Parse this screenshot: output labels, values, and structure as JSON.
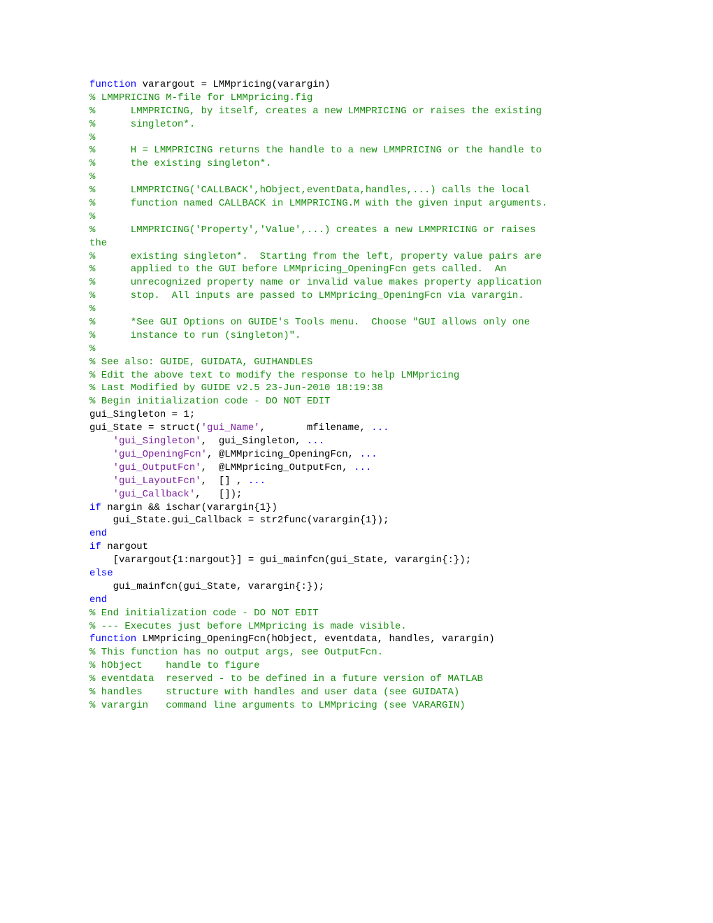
{
  "code": [
    [
      [
        "kw",
        "function"
      ],
      [
        "blk",
        " varargout = LMMpricing(varargin)"
      ]
    ],
    [
      [
        "com",
        "% LMMPRICING M-file for LMMpricing.fig"
      ]
    ],
    [
      [
        "com",
        "%      LMMPRICING, by itself, creates a new LMMPRICING or raises the existing"
      ]
    ],
    [
      [
        "com",
        "%      singleton*."
      ]
    ],
    [
      [
        "com",
        "%"
      ]
    ],
    [
      [
        "com",
        "%      H = LMMPRICING returns the handle to a new LMMPRICING or the handle to"
      ]
    ],
    [
      [
        "com",
        "%      the existing singleton*."
      ]
    ],
    [
      [
        "com",
        "%"
      ]
    ],
    [
      [
        "com",
        "%      LMMPRICING('CALLBACK',hObject,eventData,handles,...) calls the local"
      ]
    ],
    [
      [
        "com",
        "%      function named CALLBACK in LMMPRICING.M with the given input arguments."
      ]
    ],
    [
      [
        "com",
        "%"
      ]
    ],
    [
      [
        "com",
        "%      LMMPRICING('Property','Value',...) creates a new LMMPRICING or raises"
      ]
    ],
    [
      [
        "com",
        "the"
      ]
    ],
    [
      [
        "com",
        "%      existing singleton*.  Starting from the left, property value pairs are"
      ]
    ],
    [
      [
        "com",
        "%      applied to the GUI before LMMpricing_OpeningFcn gets called.  An"
      ]
    ],
    [
      [
        "com",
        "%      unrecognized property name or invalid value makes property application"
      ]
    ],
    [
      [
        "com",
        "%      stop.  All inputs are passed to LMMpricing_OpeningFcn via varargin."
      ]
    ],
    [
      [
        "com",
        "%"
      ]
    ],
    [
      [
        "com",
        "%      *See GUI Options on GUIDE's Tools menu.  Choose \"GUI allows only one"
      ]
    ],
    [
      [
        "com",
        "%      instance to run (singleton)\"."
      ]
    ],
    [
      [
        "com",
        "%"
      ]
    ],
    [
      [
        "com",
        "% See also: GUIDE, GUIDATA, GUIHANDLES"
      ]
    ],
    [
      [
        "blk",
        ""
      ]
    ],
    [
      [
        "com",
        "% Edit the above text to modify the response to help LMMpricing"
      ]
    ],
    [
      [
        "blk",
        ""
      ]
    ],
    [
      [
        "com",
        "% Last Modified by GUIDE v2.5 23-Jun-2010 18:19:38"
      ]
    ],
    [
      [
        "blk",
        ""
      ]
    ],
    [
      [
        "com",
        "% Begin initialization code - DO NOT EDIT"
      ]
    ],
    [
      [
        "blk",
        "gui_Singleton = 1;"
      ]
    ],
    [
      [
        "blk",
        "gui_State = struct("
      ],
      [
        "str",
        "'gui_Name'"
      ],
      [
        "blk",
        ",       mfilename, "
      ],
      [
        "kw",
        "..."
      ]
    ],
    [
      [
        "blk",
        "    "
      ],
      [
        "str",
        "'gui_Singleton'"
      ],
      [
        "blk",
        ",  gui_Singleton, "
      ],
      [
        "kw",
        "..."
      ]
    ],
    [
      [
        "blk",
        "    "
      ],
      [
        "str",
        "'gui_OpeningFcn'"
      ],
      [
        "blk",
        ", @LMMpricing_OpeningFcn, "
      ],
      [
        "kw",
        "..."
      ]
    ],
    [
      [
        "blk",
        "    "
      ],
      [
        "str",
        "'gui_OutputFcn'"
      ],
      [
        "blk",
        ",  @LMMpricing_OutputFcn, "
      ],
      [
        "kw",
        "..."
      ]
    ],
    [
      [
        "blk",
        "    "
      ],
      [
        "str",
        "'gui_LayoutFcn'"
      ],
      [
        "blk",
        ",  [] , "
      ],
      [
        "kw",
        "..."
      ]
    ],
    [
      [
        "blk",
        "    "
      ],
      [
        "str",
        "'gui_Callback'"
      ],
      [
        "blk",
        ",   []);"
      ]
    ],
    [
      [
        "kw",
        "if"
      ],
      [
        "blk",
        " nargin && ischar(varargin{1})"
      ]
    ],
    [
      [
        "blk",
        "    gui_State.gui_Callback = str2func(varargin{1});"
      ]
    ],
    [
      [
        "kw",
        "end"
      ]
    ],
    [
      [
        "blk",
        ""
      ]
    ],
    [
      [
        "kw",
        "if"
      ],
      [
        "blk",
        " nargout"
      ]
    ],
    [
      [
        "blk",
        "    [varargout{1:nargout}] = gui_mainfcn(gui_State, varargin{:});"
      ]
    ],
    [
      [
        "kw",
        "else"
      ]
    ],
    [
      [
        "blk",
        "    gui_mainfcn(gui_State, varargin{:});"
      ]
    ],
    [
      [
        "kw",
        "end"
      ]
    ],
    [
      [
        "com",
        "% End initialization code - DO NOT EDIT"
      ]
    ],
    [
      [
        "blk",
        ""
      ]
    ],
    [
      [
        "blk",
        ""
      ]
    ],
    [
      [
        "com",
        "% --- Executes just before LMMpricing is made visible."
      ]
    ],
    [
      [
        "kw",
        "function"
      ],
      [
        "blk",
        " LMMpricing_OpeningFcn(hObject, eventdata, handles, varargin)"
      ]
    ],
    [
      [
        "com",
        "% This function has no output args, see OutputFcn."
      ]
    ],
    [
      [
        "com",
        "% hObject    handle to figure"
      ]
    ],
    [
      [
        "com",
        "% eventdata  reserved - to be defined in a future version of MATLAB"
      ]
    ],
    [
      [
        "com",
        "% handles    structure with handles and user data (see GUIDATA)"
      ]
    ],
    [
      [
        "com",
        "% varargin   command line arguments to LMMpricing (see VARARGIN)"
      ]
    ]
  ]
}
